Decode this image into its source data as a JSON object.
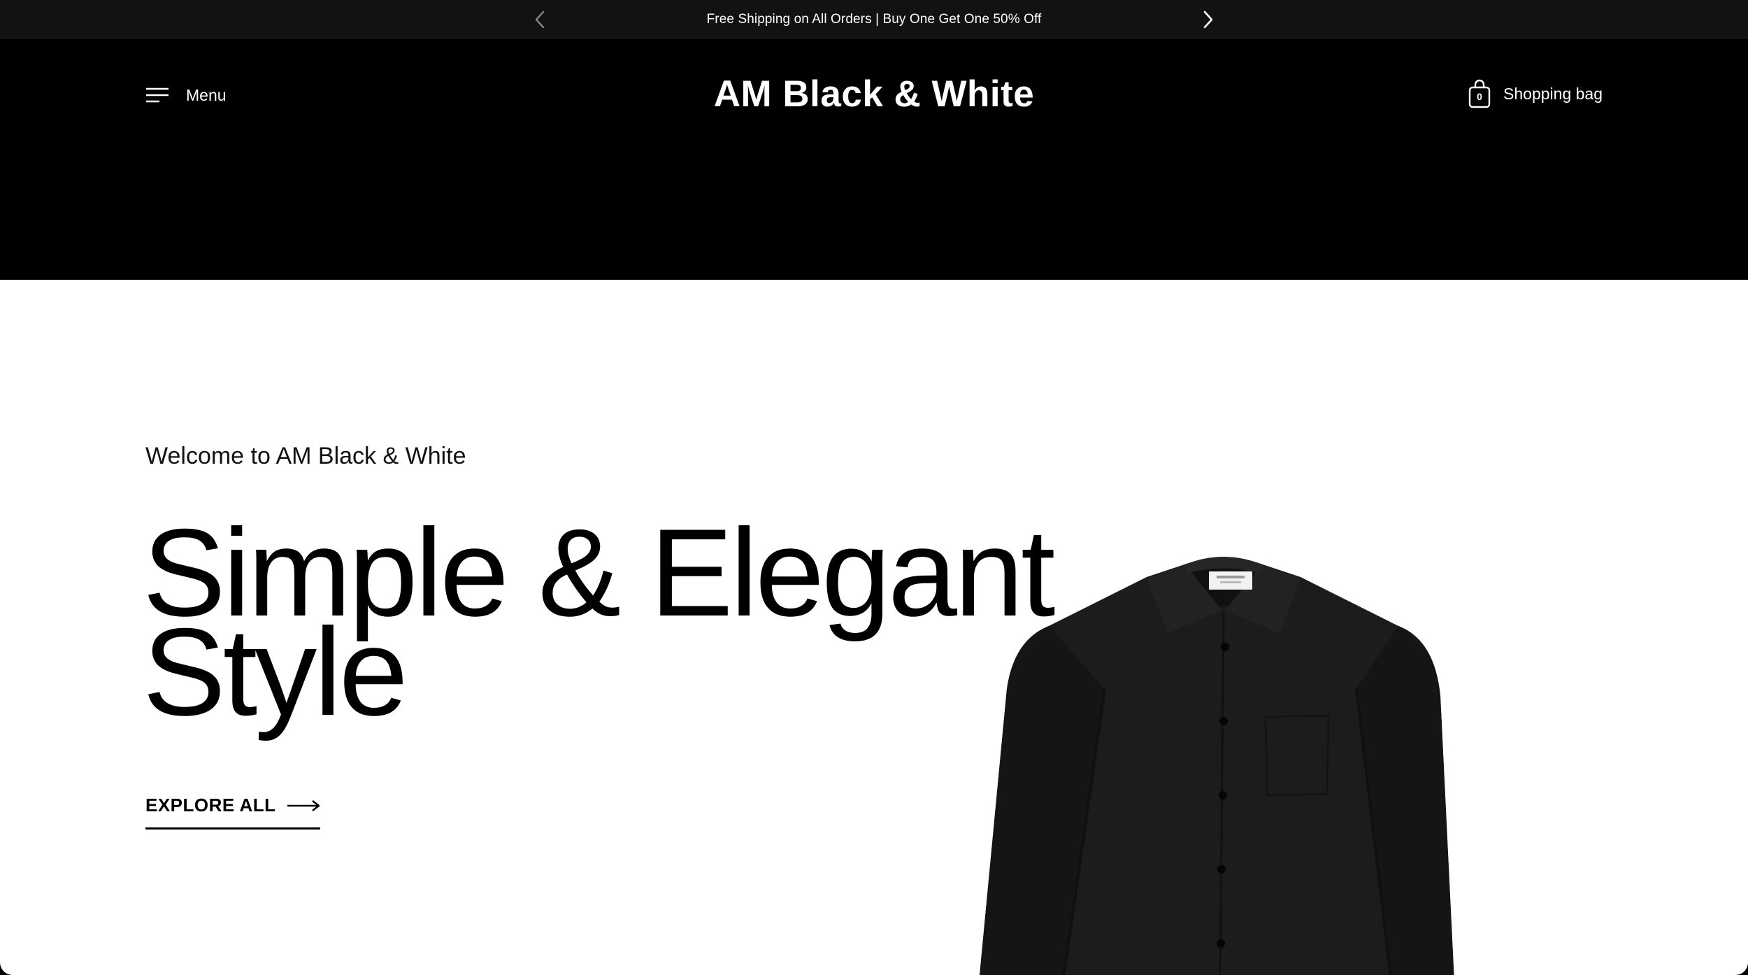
{
  "announcement": {
    "text": "Free Shipping on All Orders | Buy One Get One 50% Off",
    "prev_icon": "chevron-left-icon",
    "next_icon": "chevron-right-icon"
  },
  "header": {
    "menu_label": "Menu",
    "menu_icon": "hamburger-icon",
    "brand": "AM Black & White",
    "bag_label": "Shopping bag",
    "bag_count": "0",
    "bag_icon": "shopping-bag-icon"
  },
  "hero": {
    "welcome": "Welcome to AM Black & White",
    "headline_line1": "Simple & Elegant",
    "headline_line2": "Style",
    "cta_label": "EXPLORE ALL",
    "cta_icon": "arrow-right-icon",
    "shirt_label": "AM Black & White"
  },
  "colors": {
    "announcement_bg": "#121212",
    "header_bg": "#000000",
    "hero_bg": "#ffffff",
    "text_dark": "#000000",
    "shirt": "#1c1c1c"
  }
}
